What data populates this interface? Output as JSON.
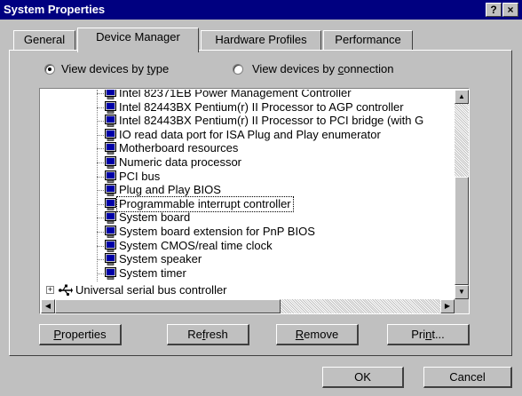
{
  "window": {
    "title": "System Properties",
    "help_button": "?",
    "close_button": "×"
  },
  "tabs": [
    {
      "label": "General",
      "active": false
    },
    {
      "label": "Device Manager",
      "active": true
    },
    {
      "label": "Hardware Profiles",
      "active": false
    },
    {
      "label": "Performance",
      "active": false
    }
  ],
  "view_options": {
    "by_type": {
      "prefix": "View devices by ",
      "accel": "t",
      "suffix": "ype",
      "selected": true
    },
    "by_connection": {
      "prefix": "View devices by ",
      "accel": "c",
      "suffix": "onnection",
      "selected": false
    }
  },
  "device_list": {
    "selected_index": 8,
    "items": [
      "Intel 82371EB Power Management Controller",
      "Intel 82443BX Pentium(r) II Processor to AGP controller",
      "Intel 82443BX Pentium(r) II Processor to PCI bridge (with G",
      "IO read data port for ISA Plug and Play enumerator",
      "Motherboard resources",
      "Numeric data processor",
      "PCI bus",
      "Plug and Play BIOS",
      "Programmable interrupt controller",
      "System board",
      "System board extension for PnP BIOS",
      "System CMOS/real time clock",
      "System speaker",
      "System timer"
    ],
    "category": {
      "expander": "+",
      "label": "Universal serial bus controller"
    }
  },
  "action_buttons": {
    "properties": {
      "pre": "",
      "accel": "P",
      "post": "roperties"
    },
    "refresh": {
      "pre": "Re",
      "accel": "f",
      "post": "resh"
    },
    "remove": {
      "pre": "",
      "accel": "R",
      "post": "emove"
    },
    "print": {
      "pre": "Pri",
      "accel": "n",
      "post": "t..."
    }
  },
  "dialog_buttons": {
    "ok": "OK",
    "cancel": "Cancel"
  },
  "icons": {
    "device": "monitor-icon",
    "usb": "usb-icon"
  },
  "colors": {
    "title_bar": "#000080",
    "window_face": "#c0c0c0",
    "icon_blue": "#0000a8"
  }
}
